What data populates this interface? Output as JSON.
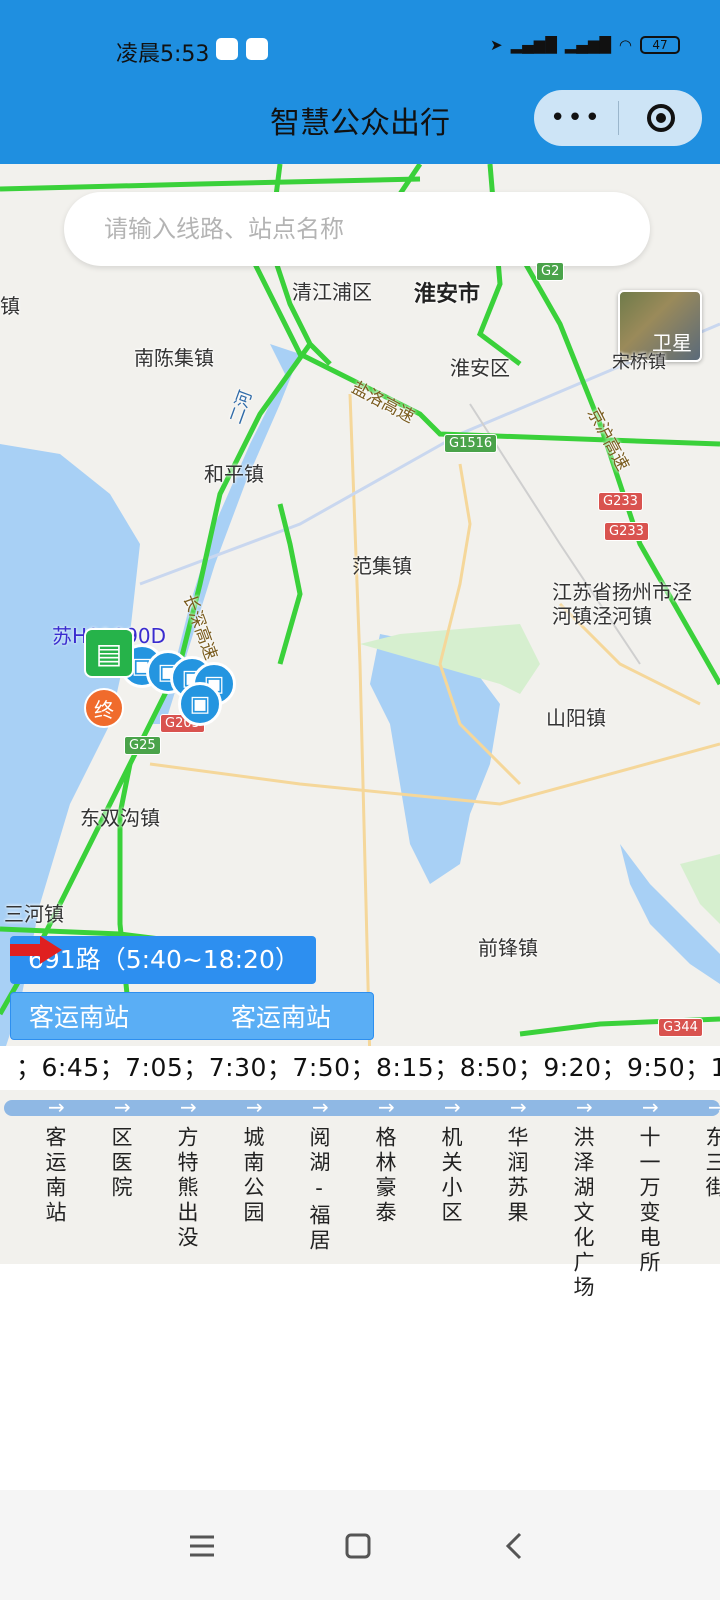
{
  "status_bar": {
    "time": "凌晨5:53",
    "battery": "47"
  },
  "title_bar": {
    "title": "智慧公众出行",
    "more": "•••"
  },
  "search": {
    "placeholder": "请输入线路、站点名称"
  },
  "satellite": {
    "label": "卫星"
  },
  "map_labels": [
    "清江浦区",
    "淮安市",
    "南陈集镇",
    "淮安区",
    "和平镇",
    "范集镇",
    "江苏省扬州市泾河镇泾河镇",
    "山阳镇",
    "东双沟镇",
    "三河镇",
    "前锋镇",
    "镇",
    "宋桥镇",
    "盐洛高速",
    "长深高速",
    "京沪高速",
    "二河"
  ],
  "road_shields": [
    "G2",
    "G1516",
    "G233",
    "G233",
    "G205",
    "G25",
    "G344"
  ],
  "bus": {
    "plate": "苏H01890D",
    "end_label": "终"
  },
  "route": {
    "name": "691路（5:40~18:20）",
    "from": "客运南站",
    "to": "客运南站"
  },
  "schedule": "；6:45；7:05；7:30；7:50；8:15；8:50；9:20；9:50；1",
  "stops": [
    "客运南站",
    "区医院",
    "方特熊出没",
    "城南公园",
    "阅湖-福居",
    "格林豪泰",
    "机关小区",
    "华润苏果",
    "洪泽湖文化广场",
    "十一万变电所",
    "东三街"
  ],
  "colors": {
    "primary": "#1f8fe0",
    "route_blue": "#2d8ff0",
    "highway_green": "#3ad13a",
    "end_orange": "#f06b2c"
  }
}
